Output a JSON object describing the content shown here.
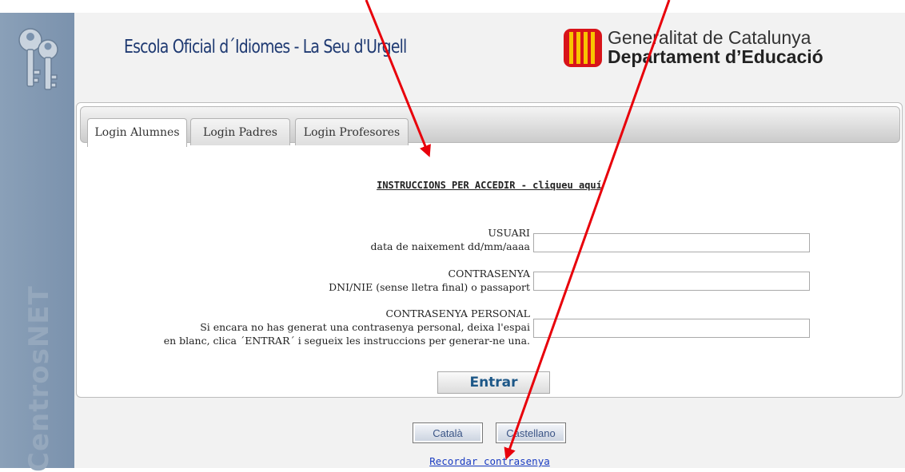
{
  "sidebar": {
    "brand": "CentrosNET"
  },
  "header": {
    "school_title": "Escola Oficial d´Idiomes - La Seu d'Urgell",
    "gov_line1": "Generalitat de Catalunya",
    "gov_line2": "Departament d’Educació"
  },
  "tabs": [
    "Login Alumnes",
    "Login Padres",
    "Login Profesores"
  ],
  "instructions_link": "INSTRUCCIONS PER ACCEDIR - cliqueu aquí",
  "form": {
    "user_label": "USUARI",
    "user_hint": "data de naixement dd/mm/aaaa",
    "pass_label": "CONTRASENYA",
    "pass_hint": "DNI/NIE (sense lletra final) o passaport",
    "personal_label": "CONTRASENYA PERSONAL",
    "personal_hint1": "Si encara no has generat una contrasenya personal, deixa l'espai",
    "personal_hint2": "en blanc, clica ´ENTRAR´ i segueix les instruccions per generar-ne una.",
    "submit": "Entrar"
  },
  "languages": [
    "Català",
    "Castellano"
  ],
  "forgot_link": "Recordar contrasenya",
  "colors": {
    "arrow": "#e8000b",
    "title": "#1f3a72",
    "sidebar": "#7b92ad"
  }
}
